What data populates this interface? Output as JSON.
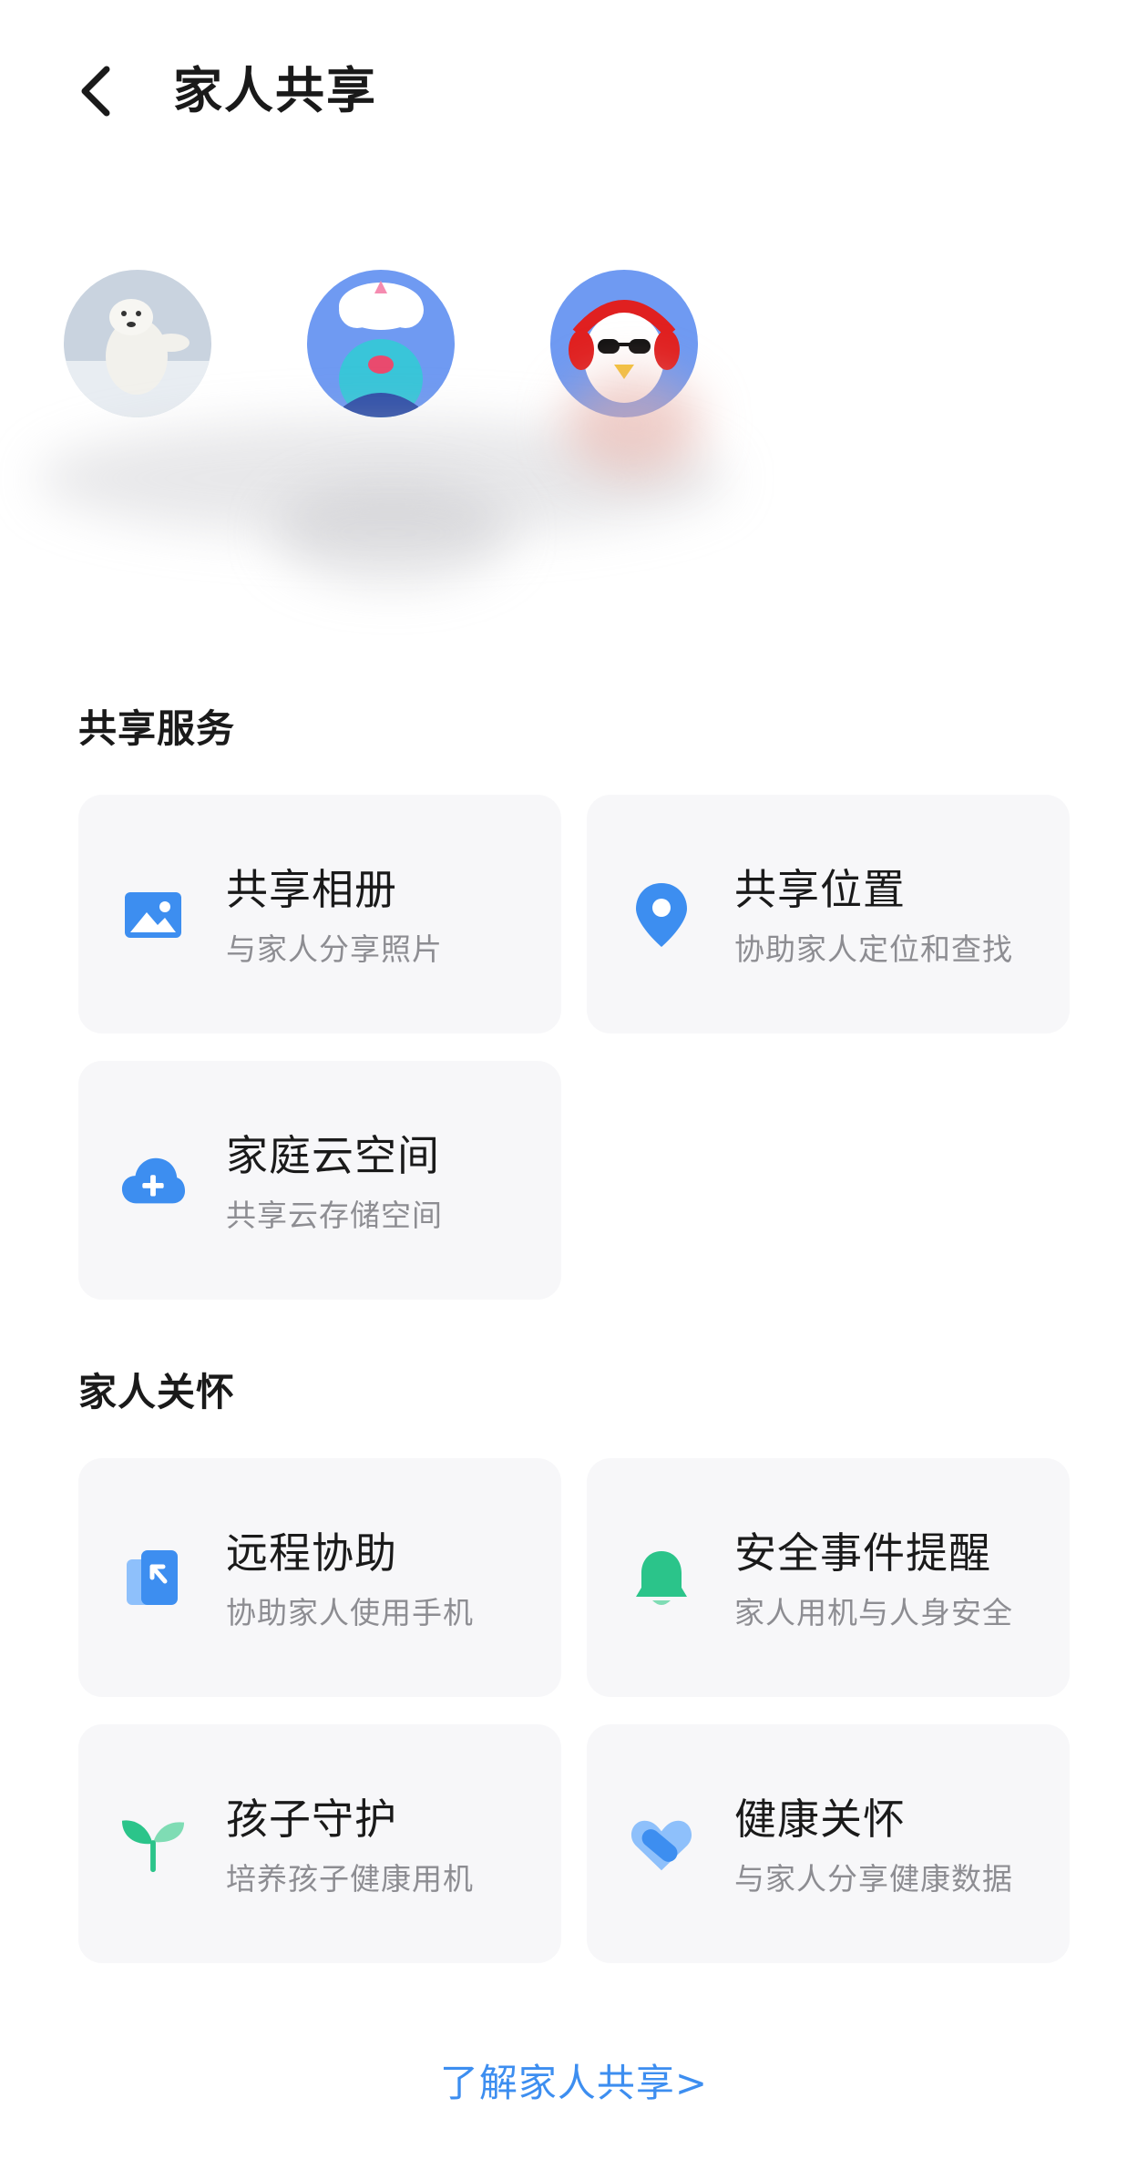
{
  "header": {
    "title": "家人共享"
  },
  "sections": {
    "shared_services": {
      "title": "共享服务",
      "cards": [
        {
          "title": "共享相册",
          "subtitle": "与家人分享照片",
          "icon": "photo-album-icon"
        },
        {
          "title": "共享位置",
          "subtitle": "协助家人定位和查找",
          "icon": "location-pin-icon"
        },
        {
          "title": "家庭云空间",
          "subtitle": "共享云存储空间",
          "icon": "cloud-add-icon"
        }
      ]
    },
    "family_care": {
      "title": "家人关怀",
      "cards": [
        {
          "title": "远程协助",
          "subtitle": "协助家人使用手机",
          "icon": "remote-assist-icon"
        },
        {
          "title": "安全事件提醒",
          "subtitle": "家人用机与人身安全",
          "icon": "bell-icon"
        },
        {
          "title": "孩子守护",
          "subtitle": "培养孩子健康用机",
          "icon": "sprout-icon"
        },
        {
          "title": "健康关怀",
          "subtitle": "与家人分享健康数据",
          "icon": "health-heart-icon"
        }
      ]
    }
  },
  "footer": {
    "learn_more": "了解家人共享>"
  },
  "colors": {
    "accent_blue": "#3d8ef0",
    "green": "#2bc48a",
    "card_bg": "#f7f7f9",
    "subtitle_gray": "#8d8d92"
  }
}
